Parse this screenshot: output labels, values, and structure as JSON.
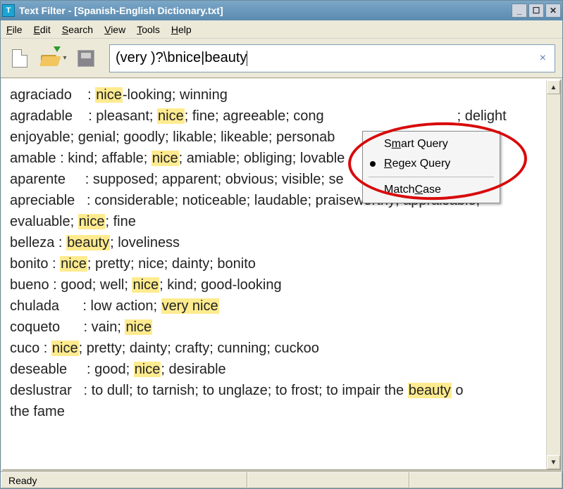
{
  "title": "Text Filter - [Spanish-English Dictionary.txt]",
  "menu": {
    "file": "File",
    "edit": "Edit",
    "search": "Search",
    "view": "View",
    "tools": "Tools",
    "help": "Help"
  },
  "search": {
    "value": "(very )?\\bnice|beauty"
  },
  "context": {
    "smart": "Smart Query",
    "regex": "Regex Query",
    "matchcase": "Match Case"
  },
  "results": [
    {
      "word": "agraciado",
      "text": ": {nice}-looking; winning"
    },
    {
      "word": "agradable",
      "text": ": pleasant; {nice}; fine; agreeable; cong                                  ; delight"
    },
    {
      "word": "",
      "text": "enjoyable; genial; goodly; likable; likeable; personab"
    },
    {
      "word": "amable",
      "text": ": kind; affable; {nice}; amiable; obliging; lovable",
      "tight": true
    },
    {
      "word": "aparente",
      "text": ": supposed; apparent; obvious; visible; se                   ely; {nice}"
    },
    {
      "word": "apreciable",
      "text": ": considerable; noticeable; laudable; praiseworthy; appraisable;"
    },
    {
      "word": "",
      "text": "evaluable; {nice}; fine"
    },
    {
      "word": "belleza",
      "text": ": {beauty}; loveliness",
      "tight": true
    },
    {
      "word": "bonito",
      "text": ": {nice}; pretty; nice; dainty; bonito",
      "tight": true
    },
    {
      "word": "bueno",
      "text": ": good; well; {nice}; kind; good-looking",
      "tight": true
    },
    {
      "word": "chulada",
      "text": ": low action; {very nice}"
    },
    {
      "word": "coqueto",
      "text": ": vain; {nice}"
    },
    {
      "word": "cuco",
      "text": ": {nice}; pretty; dainty; crafty; cunning; cuckoo",
      "tight": true,
      "narrow": true
    },
    {
      "word": "deseable",
      "text": ": good; {nice}; desirable"
    },
    {
      "word": "deslustrar",
      "text": ": to dull; to tarnish; to unglaze; to frost; to impair the {beauty} o"
    },
    {
      "word": "",
      "text": "the fame"
    }
  ],
  "status": {
    "ready": "Ready"
  }
}
